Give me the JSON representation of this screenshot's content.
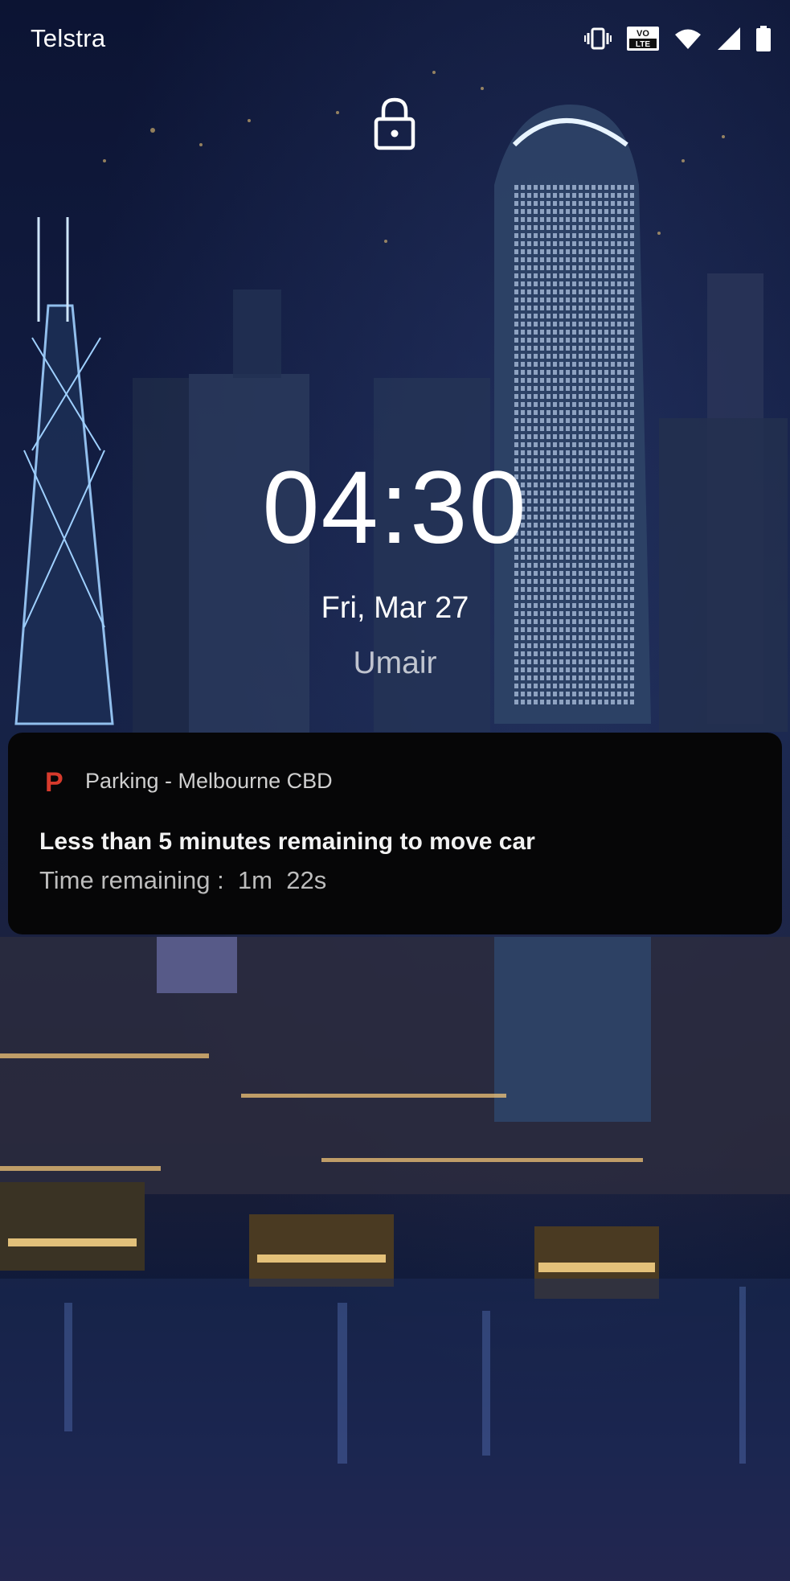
{
  "status_bar": {
    "carrier": "Telstra",
    "icons": [
      "vibrate-icon",
      "volte-icon",
      "wifi-icon",
      "cellular-signal-icon",
      "battery-icon"
    ],
    "volte_top": "VO",
    "volte_bottom": "LTE"
  },
  "lockscreen": {
    "lock_icon": "lock-icon",
    "time": "04:30",
    "date": "Fri, Mar 27",
    "owner": "Umair"
  },
  "notification": {
    "app_icon_letter": "P",
    "app_icon_color": "#d63a2c",
    "app_name": "Parking - Melbourne CBD",
    "title": "Less than 5 minutes remaining to move car",
    "body": "Time remaining :  1m  22s"
  }
}
